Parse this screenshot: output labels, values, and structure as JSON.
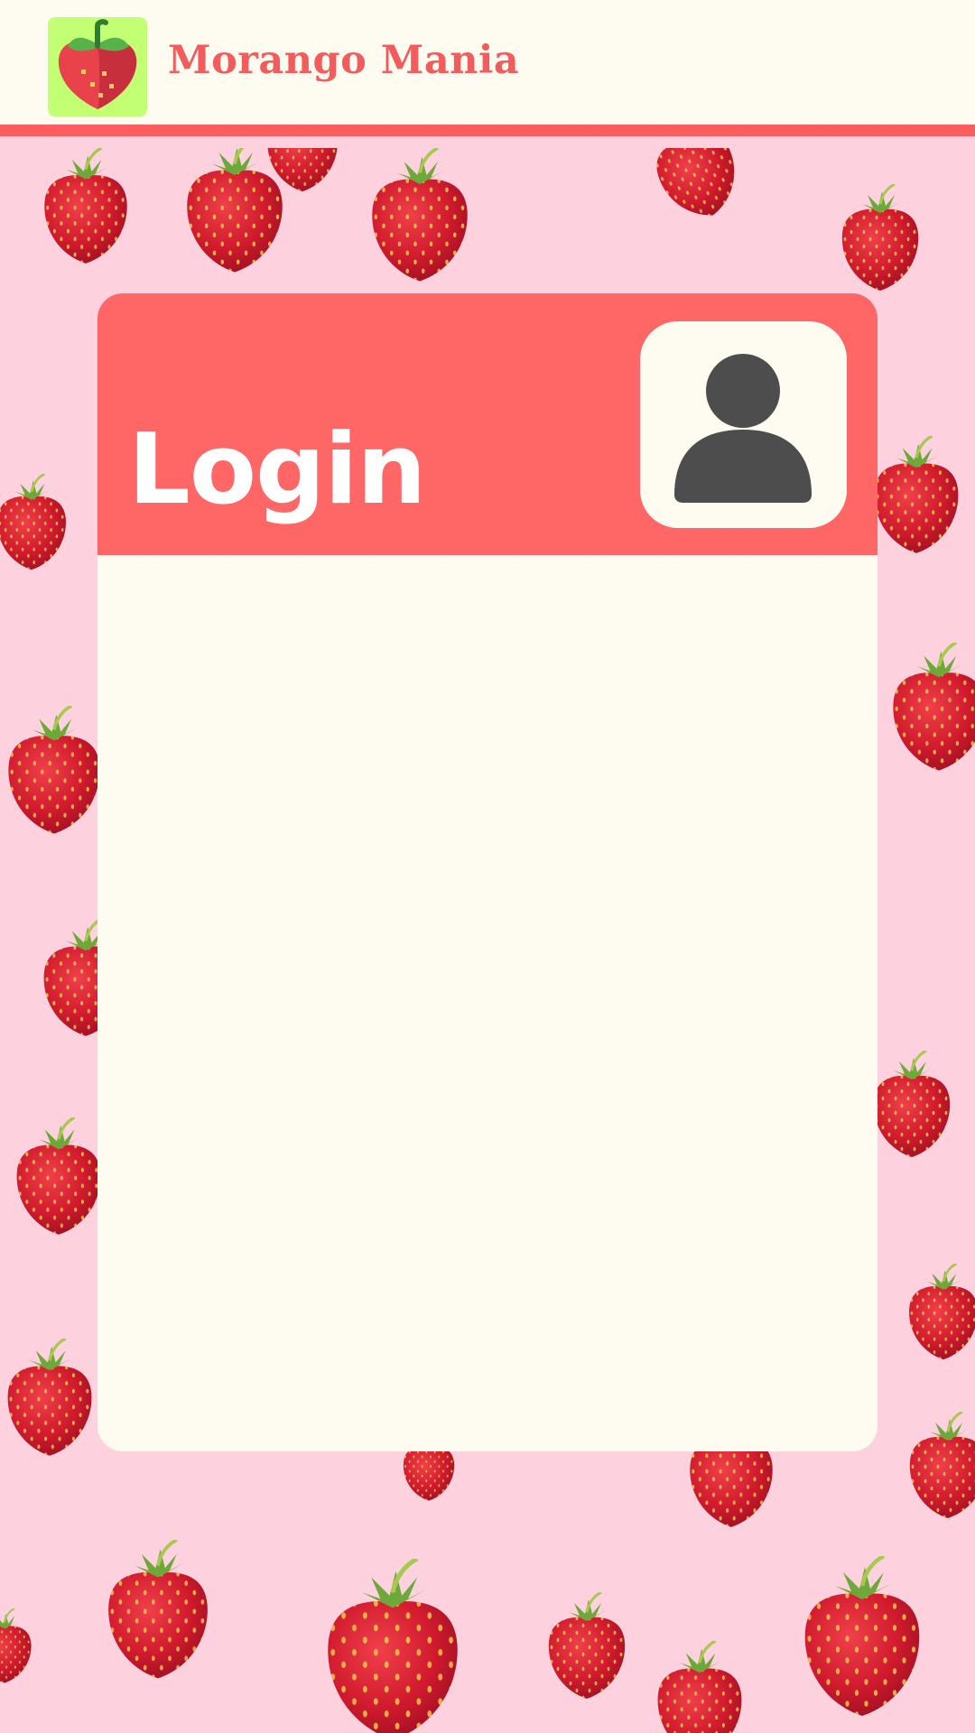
{
  "app": {
    "name": "Morango Mania",
    "logo_icon": "strawberry-logo-icon"
  },
  "login_card": {
    "title": "Login",
    "avatar_icon": "user-avatar-icon"
  },
  "background": {
    "pattern_icon": "strawberry-icon"
  },
  "colors": {
    "page_background": "#FED1DF",
    "header_background": "#FEFCF1",
    "accent": "#FF5E5E",
    "card_header": "#FF6666",
    "card_body": "#FEFCF1",
    "logo_background": "#C2FF72",
    "avatar_fill": "#4D4D4D"
  }
}
